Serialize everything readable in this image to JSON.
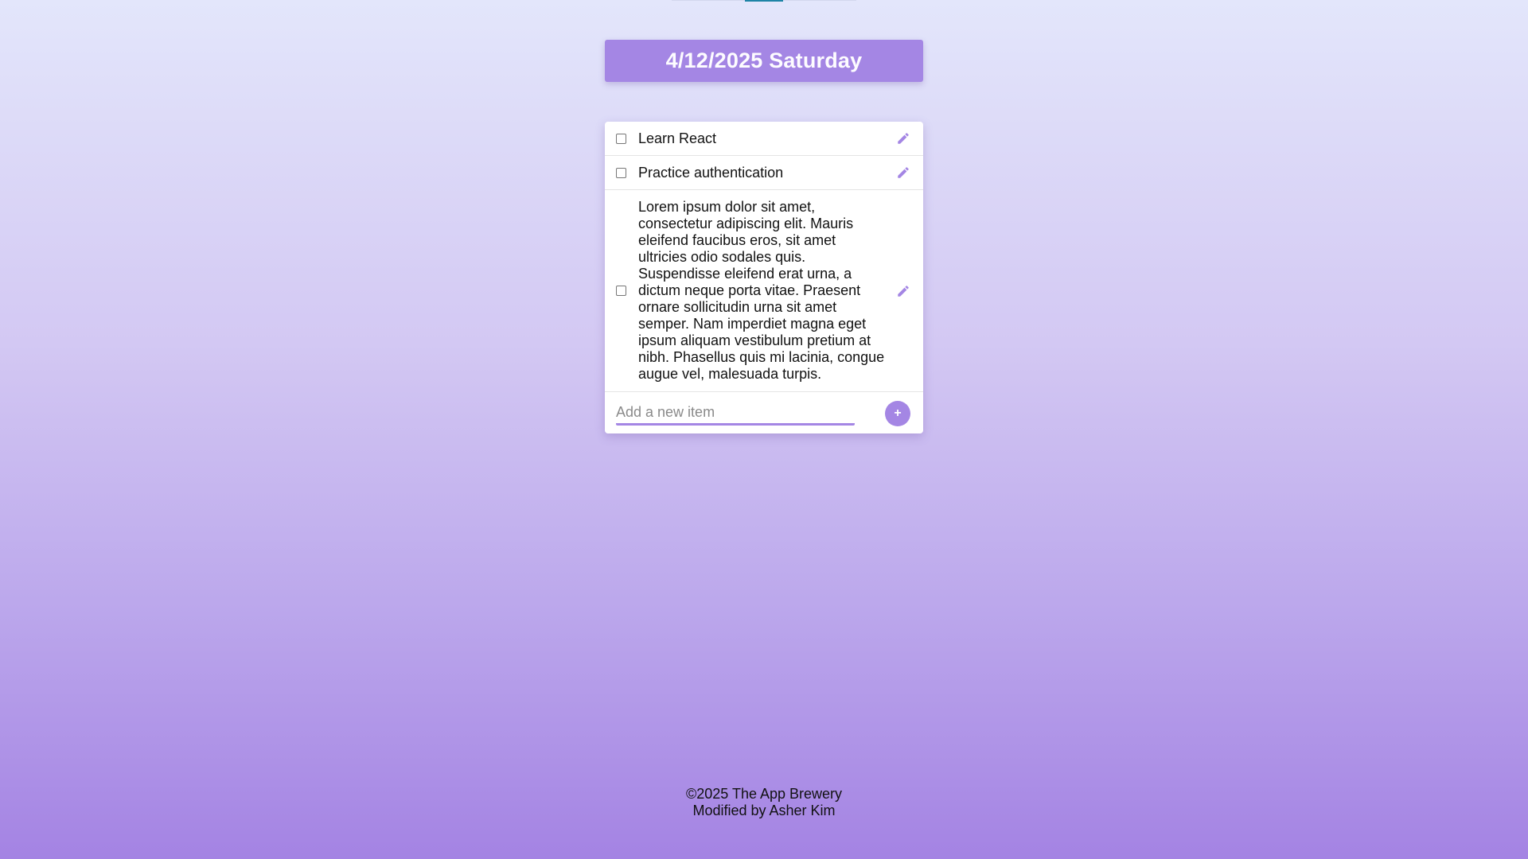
{
  "date_heading": "4/12/2025 Saturday",
  "todo": {
    "items": [
      {
        "title": "Learn React",
        "checked": false,
        "edit_icon": "pencil-icon"
      },
      {
        "title": "Practice authentication",
        "checked": false,
        "edit_icon": "pencil-icon"
      },
      {
        "title": "Lorem ipsum dolor sit amet, consectetur adipiscing elit. Mauris eleifend faucibus eros, sit amet ultricies odio sodales quis. Suspendisse eleifend erat urna, a dictum neque porta vitae. Praesent ornare sollicitudin urna sit amet semper. Nam imperdiet magna eget ipsum aliquam vestibulum pretium at nibh. Phasellus quis mi lacinia, congue augue vel, malesuada turpis.",
        "checked": false,
        "edit_icon": "pencil-icon"
      }
    ],
    "new_item": {
      "value": "",
      "placeholder": "Add a new item",
      "add_label": "+"
    }
  },
  "footer": {
    "copyright": "©2025 The App Brewery",
    "modified": "Modified by Asher Kim"
  },
  "colors": {
    "accent": "#a486e4",
    "nav_active": "#1f84a6",
    "background_top": "#e3e6fb",
    "background_bottom": "#a483e3"
  }
}
